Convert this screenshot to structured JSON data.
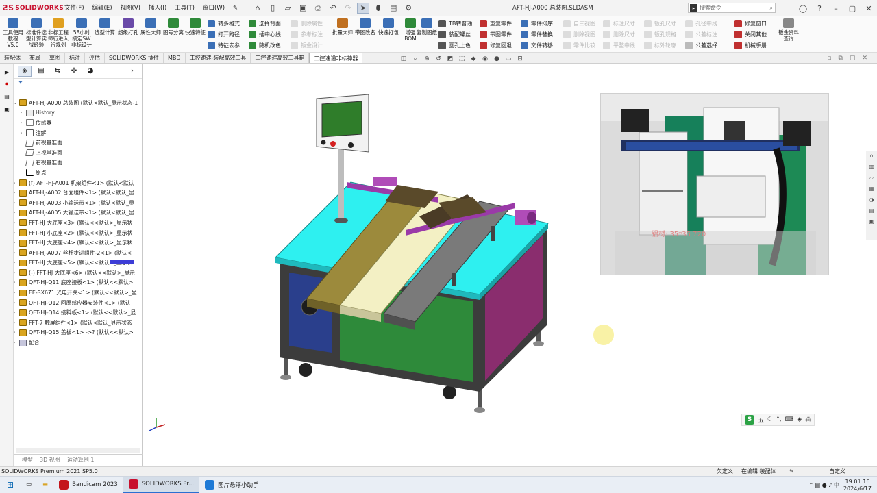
{
  "app": {
    "logo_text": "SOLIDWORKS",
    "document_title": "AFT-HJ-A000 总装图.SLDASM",
    "menus": [
      "文件(F)",
      "编辑(E)",
      "视图(V)",
      "插入(I)",
      "工具(T)",
      "窗口(W)"
    ],
    "search_placeholder": "搜索命令"
  },
  "ribbon": {
    "big_buttons": [
      {
        "label": "工具使用教程V5.0",
        "icon": "book-icon"
      },
      {
        "label": "标准件选型计算实战经验",
        "icon": "calc-icon"
      },
      {
        "label": "非标工程师行进入行规划",
        "icon": "person-icon"
      },
      {
        "label": "58小时搞定SW非标设计",
        "icon": "clock-icon"
      },
      {
        "label": "选型计算",
        "icon": "calc-icon"
      },
      {
        "label": "超级打孔",
        "icon": "drill-icon"
      },
      {
        "label": "属性大师",
        "icon": "prop-icon"
      },
      {
        "label": "图号分离",
        "icon": "split-icon"
      },
      {
        "label": "快速特征",
        "icon": "feature-icon"
      },
      {
        "label": "批量大师",
        "icon": "batch-icon"
      },
      {
        "label": "带图改名",
        "icon": "rename-icon"
      },
      {
        "label": "快速打包",
        "icon": "pack-icon"
      },
      {
        "label": "增强BOM",
        "icon": "bom-icon"
      },
      {
        "label": "复制图纸",
        "icon": "copy-icon"
      },
      {
        "label": "钣金资料查询",
        "icon": "sheet-icon"
      }
    ],
    "col1": [
      {
        "label": "转多格式",
        "enabled": true
      },
      {
        "label": "打开路径",
        "enabled": true
      },
      {
        "label": "特征去参",
        "enabled": true
      }
    ],
    "col2": [
      {
        "label": "选择背面",
        "enabled": true
      },
      {
        "label": "插中心线",
        "enabled": true
      },
      {
        "label": "随机改色",
        "enabled": true
      }
    ],
    "col3": [
      {
        "label": "删除属性",
        "enabled": false
      },
      {
        "label": "参考标注",
        "enabled": false
      },
      {
        "label": "钣金设计",
        "enabled": false
      }
    ],
    "col4": [
      {
        "label": "TB转普通",
        "enabled": true
      },
      {
        "label": "装配螺丝",
        "enabled": true
      },
      {
        "label": "圆孔上色",
        "enabled": true
      }
    ],
    "col5": [
      {
        "label": "重复零件",
        "enabled": true
      },
      {
        "label": "带图零件",
        "enabled": true
      },
      {
        "label": "修复回退",
        "enabled": true
      }
    ],
    "col6": [
      {
        "label": "零件排序",
        "enabled": true
      },
      {
        "label": "零件替换",
        "enabled": true
      },
      {
        "label": "文件转移",
        "enabled": true
      }
    ],
    "col7": [
      {
        "label": "自三视图",
        "enabled": false
      },
      {
        "label": "删除视图",
        "enabled": false
      },
      {
        "label": "零件比较",
        "enabled": false
      }
    ],
    "col8": [
      {
        "label": "标注尺寸",
        "enabled": false
      },
      {
        "label": "删除尺寸",
        "enabled": false
      },
      {
        "label": "平整中线",
        "enabled": false
      }
    ],
    "col9": [
      {
        "label": "钣孔尺寸",
        "enabled": false
      },
      {
        "label": "钣孔规格",
        "enabled": false
      },
      {
        "label": "标外轮廓",
        "enabled": false
      }
    ],
    "col10": [
      {
        "label": "孔径中线",
        "enabled": false
      },
      {
        "label": "公差标注",
        "enabled": false
      },
      {
        "label": "公差选择",
        "enabled": true
      }
    ],
    "col11": [
      {
        "label": "修复窗口",
        "enabled": true
      },
      {
        "label": "关闭其他",
        "enabled": true
      },
      {
        "label": "机械手册",
        "enabled": true
      }
    ]
  },
  "cmd_tabs": [
    "装配体",
    "布局",
    "草图",
    "标注",
    "评估",
    "SOLIDWORKS 插件",
    "MBD",
    "工控速递-装配高效工具",
    "工控速递高效工具箱",
    "工控速递非标神器"
  ],
  "active_tab": "工控速递非标神器",
  "feature_tree": {
    "root": "AFT-HJ-A000 总装图 (默认<默认_显示状态-1",
    "items": [
      {
        "label": "History",
        "icon": "hist"
      },
      {
        "label": "传感器",
        "icon": "sens"
      },
      {
        "label": "注解",
        "icon": "ann"
      },
      {
        "label": "前视基准面",
        "icon": "plane"
      },
      {
        "label": "上视基准面",
        "icon": "plane"
      },
      {
        "label": "右视基准面",
        "icon": "plane"
      },
      {
        "label": "原点",
        "icon": "origin"
      },
      {
        "label": "(f) AFT-HJ-A001 机架组件<1> (默认<默认",
        "icon": "asm"
      },
      {
        "label": "AFT-HJ-A002 台面组件<1> (默认<默认_显",
        "icon": "asm"
      },
      {
        "label": "AFT-HJ-A003 小输送带<1> (默认<默认_显",
        "icon": "asm"
      },
      {
        "label": "AFT-HJ-A005 大输送带<1> (默认<默认_显",
        "icon": "asm"
      },
      {
        "label": "FFT-HJ 大底座<3> (默认<<默认>_显示状",
        "icon": "asm"
      },
      {
        "label": "FFT-HJ 小底座<2> (默认<<默认>_显示状",
        "icon": "asm"
      },
      {
        "label": "FFT-HJ 大底座<4> (默认<<默认>_显示状",
        "icon": "asm"
      },
      {
        "label": "AFT-HJ-A007 丝杆步进组件-2<1> (默认<",
        "icon": "asm"
      },
      {
        "label": "FFT-HJ 大底座<5> (默认<<默认>_显示状",
        "icon": "asm"
      },
      {
        "label": "(-) FFT-HJ 大底座<6> (默认<<默认>_显示",
        "icon": "asm"
      },
      {
        "label": "QFT-HJ-Q11 底座接板<1> (默认<<默认>",
        "icon": "asm"
      },
      {
        "label": "EE-SX671 光电开关<1> (默认<<默认>_显",
        "icon": "asm"
      },
      {
        "label": "QFT-HJ-Q12 回原感应器安装件<1> (默认",
        "icon": "asm"
      },
      {
        "label": "QFT-HJ-Q14 接料板<1> (默认<<默认>_显",
        "icon": "asm"
      },
      {
        "label": "FFT-7 触屏组件<1> (默认<默认_显示状态",
        "icon": "asm"
      },
      {
        "label": "QFT-HJ-Q15 盖板<1> ->? (默认<<默认>",
        "icon": "asm"
      },
      {
        "label": "配合",
        "icon": "mate"
      }
    ],
    "bottom_tabs": [
      "模型",
      "3D 视图",
      "运动算例 1"
    ]
  },
  "photo_caption": "铝材: 35*35  720",
  "ime_text": "五",
  "status": {
    "left": "SOLIDWORKS Premium 2021 SP5.0",
    "undefined": "欠定义",
    "editing": "在编辑 装配体",
    "custom": "自定义"
  },
  "taskbar": {
    "items": [
      {
        "label": "Bandicam 2023",
        "icon_color": "#c4161c",
        "active": false
      },
      {
        "label": "SOLIDWORKS Pr...",
        "icon_color": "#c8102e",
        "active": true
      },
      {
        "label": "图片悬浮小助手",
        "icon_color": "#1e7ad6",
        "active": false
      }
    ],
    "time": "19:01:16",
    "date": "2024/6/17"
  },
  "colors": {
    "accent": "#c8102e",
    "table_top": "#2ef0f0",
    "frame": "#3c3c3c",
    "blue_panel": "#2a3f8c",
    "green_panel": "#2e8a3a",
    "purple_panel": "#8a2d6e",
    "belt_olive": "#9c8a3c",
    "belt_cream": "#f3f0c4",
    "belt_grey": "#7a7a7a",
    "purple_rail": "#9a3aa8"
  }
}
